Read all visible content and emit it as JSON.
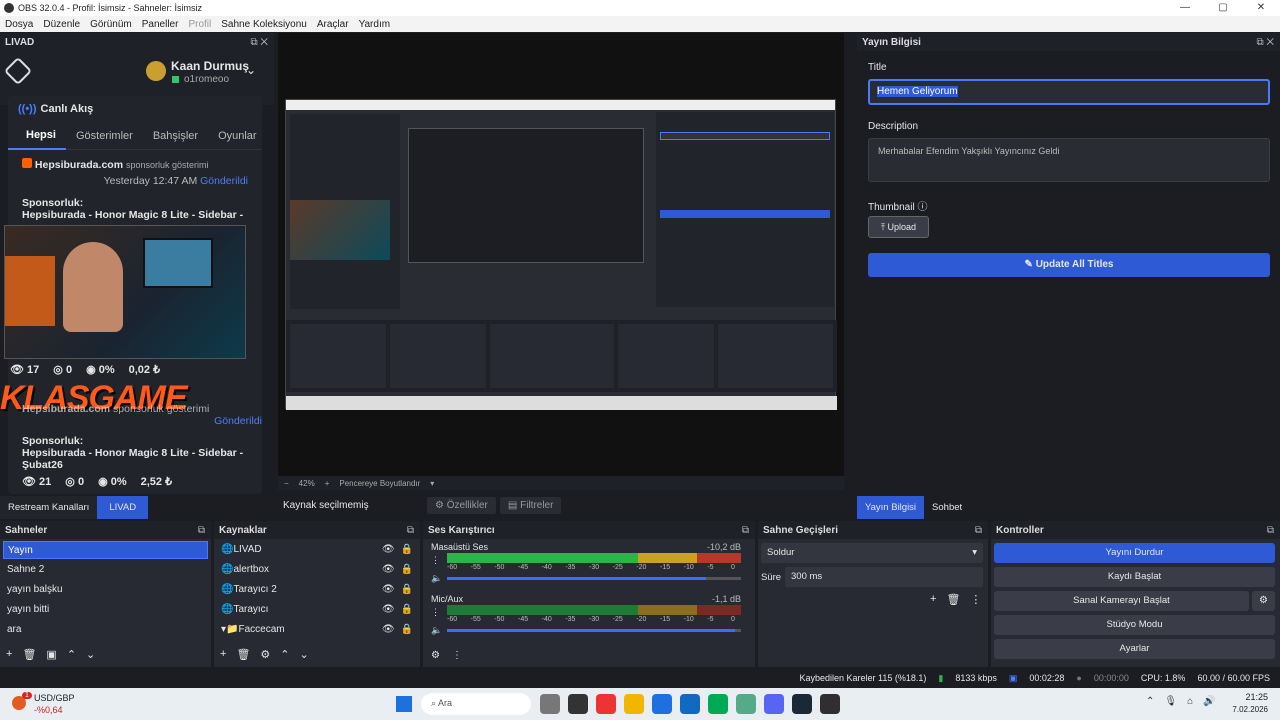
{
  "window": {
    "title": "OBS 32.0.4 - Profil: İsimsiz - Sahneler: İsimsiz",
    "min": "—",
    "max": "▢",
    "close": "✕"
  },
  "menu": [
    "Dosya",
    "Düzenle",
    "Görünüm",
    "Paneller",
    "Profil",
    "Sahne Koleksiyonu",
    "Araçlar",
    "Yardım"
  ],
  "livad": {
    "dock_title": "LIVAD",
    "user_name": "Kaan Durmuş",
    "user_handle": "o1romeoo",
    "live_title": "Canlı Akış",
    "tabs": [
      "Hepsi",
      "Gösterimler",
      "Bahşişler",
      "Oyunlar"
    ],
    "card1": {
      "source": "Hepsiburada.com",
      "suffix": "sponsorluk gösterimi",
      "time": "Yesterday 12:47 AM",
      "status": "Gönderildi",
      "label": "Sponsorluk:",
      "text": "Hepsiburada - Honor Magic 8 Lite - Sidebar -"
    },
    "stats1": {
      "views": "17",
      "comments": "0",
      "pct": "0%",
      "money": "0,02 ₺"
    },
    "card2": {
      "source": "Hepsiburada.com",
      "suffix": "sponsorluk gösterimi",
      "status": "Gönderildi",
      "label": "Sponsorluk:",
      "text": "Hepsiburada - Honor Magic 8 Lite - Sidebar - Şubat26"
    },
    "stats2": {
      "views": "21",
      "comments": "0",
      "pct": "0%",
      "money": "2,52 ₺"
    },
    "overlay": "KLASGAME"
  },
  "preview": {
    "zoom": "42%",
    "fit": "Pencereye Boyutlandır"
  },
  "source_bar": {
    "none": "Kaynak seçilmemiş",
    "props": "Özellikler",
    "filters": "Filtreler"
  },
  "bottom_tabs_left": [
    "Restream Kanalları",
    "LIVAD"
  ],
  "bottom_tabs_right": [
    "Yayın Bilgisi",
    "Sohbet"
  ],
  "info": {
    "dock_title": "Yayın Bilgisi",
    "title_label": "Title",
    "title_value": "Hemen Geliyorum",
    "desc_label": "Description",
    "desc_value": "Merhabalar Efendim  Yakşıklı Yayıncınız Geldi",
    "thumb_label": "Thumbnail",
    "upload": "Upload",
    "update": "Update All Titles"
  },
  "scenes": {
    "title": "Sahneler",
    "items": [
      "Yayın",
      "Sahne 2",
      "yayın balşku",
      "yayın bitti",
      "ara"
    ]
  },
  "sources": {
    "title": "Kaynaklar",
    "items": [
      "LIVAD",
      "alertbox",
      "Tarayıcı 2",
      "Tarayıcı",
      "Faccecam"
    ]
  },
  "mixer": {
    "title": "Ses Karıştırıcı",
    "ch1": {
      "name": "Masaüstü Ses",
      "db": "-10,2 dB",
      "vol": 0.88
    },
    "ch2": {
      "name": "Mic/Aux",
      "db": "-1,1 dB",
      "vol": 0.98
    },
    "ticks": [
      "-60",
      "-55",
      "-50",
      "-45",
      "-40",
      "-35",
      "-30",
      "-25",
      "-20",
      "-15",
      "-10",
      "-5",
      "0"
    ]
  },
  "transitions": {
    "title": "Sahne Geçişleri",
    "type": "Soldur",
    "duration_label": "Süre",
    "duration": "300 ms"
  },
  "controls": {
    "title": "Kontroller",
    "buttons": [
      "Yayını Durdur",
      "Kaydı Başlat",
      "Sanal Kamerayı Başlat",
      "Stüdyo Modu",
      "Ayarlar"
    ]
  },
  "status": {
    "dropped": "Kaybedilen Kareler 115 (%18.1)",
    "kbps": "8133 kbps",
    "stream_time": "00:02:28",
    "rec_time": "00:00:00",
    "cpu": "CPU: 1.8%",
    "fps": "60.00 / 60.00 FPS"
  },
  "taskbar": {
    "ticker": "USD/GBP",
    "change": "-%0,64",
    "badge": "1",
    "search": "Ara",
    "time": "21:25",
    "date": "7.02.2026"
  },
  "colors": {
    "accent": "#2f5ad6",
    "live": "#4a7dff"
  }
}
